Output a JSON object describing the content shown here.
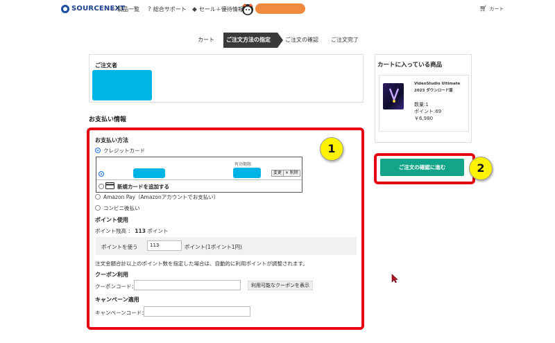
{
  "header": {
    "logo": "SOURCENEXT",
    "nav": [
      {
        "icon": "search-icon",
        "label": "製品一覧"
      },
      {
        "icon": "question-icon",
        "label": "総合サポート"
      },
      {
        "icon": "tag-icon",
        "label": "セール＋優待情報"
      }
    ],
    "cart_label": "カート"
  },
  "steps": [
    "カート",
    "ご注文方法の指定",
    "ご注文の確認",
    "ご注文完了"
  ],
  "orderer": {
    "title": "ご注文者"
  },
  "payment": {
    "section_title": "お支払い情報",
    "method_title": "お支払い方法",
    "credit_card": "クレジットカード",
    "expiry_label": "有効期限",
    "change_btn": "変更",
    "delete_btn": "✕ 削除",
    "add_card": "新規カードを追加する",
    "amazon_pay": "Amazon Pay（Amazonアカウントでお支払い）",
    "convenience": "コンビニ後払い"
  },
  "points": {
    "title": "ポイント使用",
    "balance_label": "ポイント残高 ：",
    "balance_value": "113",
    "balance_unit": "ポイント",
    "use_label": "ポイントを使う",
    "use_value": "113",
    "use_unit": "ポイント(1ポイント1円)",
    "note": "注文金額合計以上のポイント数を指定した場合は、自動的に利用ポイントが調整されます。"
  },
  "coupon": {
    "title": "クーポン利用",
    "code_label": "クーポンコード：",
    "show_btn": "利用可能なクーポンを表示"
  },
  "campaign": {
    "title": "キャンペーン適用",
    "code_label": "キャンペーンコード："
  },
  "cart": {
    "title": "カートに入っている商品",
    "product_name_1": "VideoStudio Ultimate",
    "product_name_2": "2023 ダウンロード版",
    "quantity": "数量:1",
    "points": "ポイント:69",
    "price": "￥6,980",
    "confirm_btn": "ご注文の確認に進む"
  },
  "badges": {
    "one": "1",
    "two": "2"
  },
  "colors": {
    "accent_green": "#13a589",
    "highlight_red": "#e60012",
    "badge_yellow": "#fff200",
    "redaction": "#00b4e6",
    "brand_orange": "#f08a3c"
  }
}
